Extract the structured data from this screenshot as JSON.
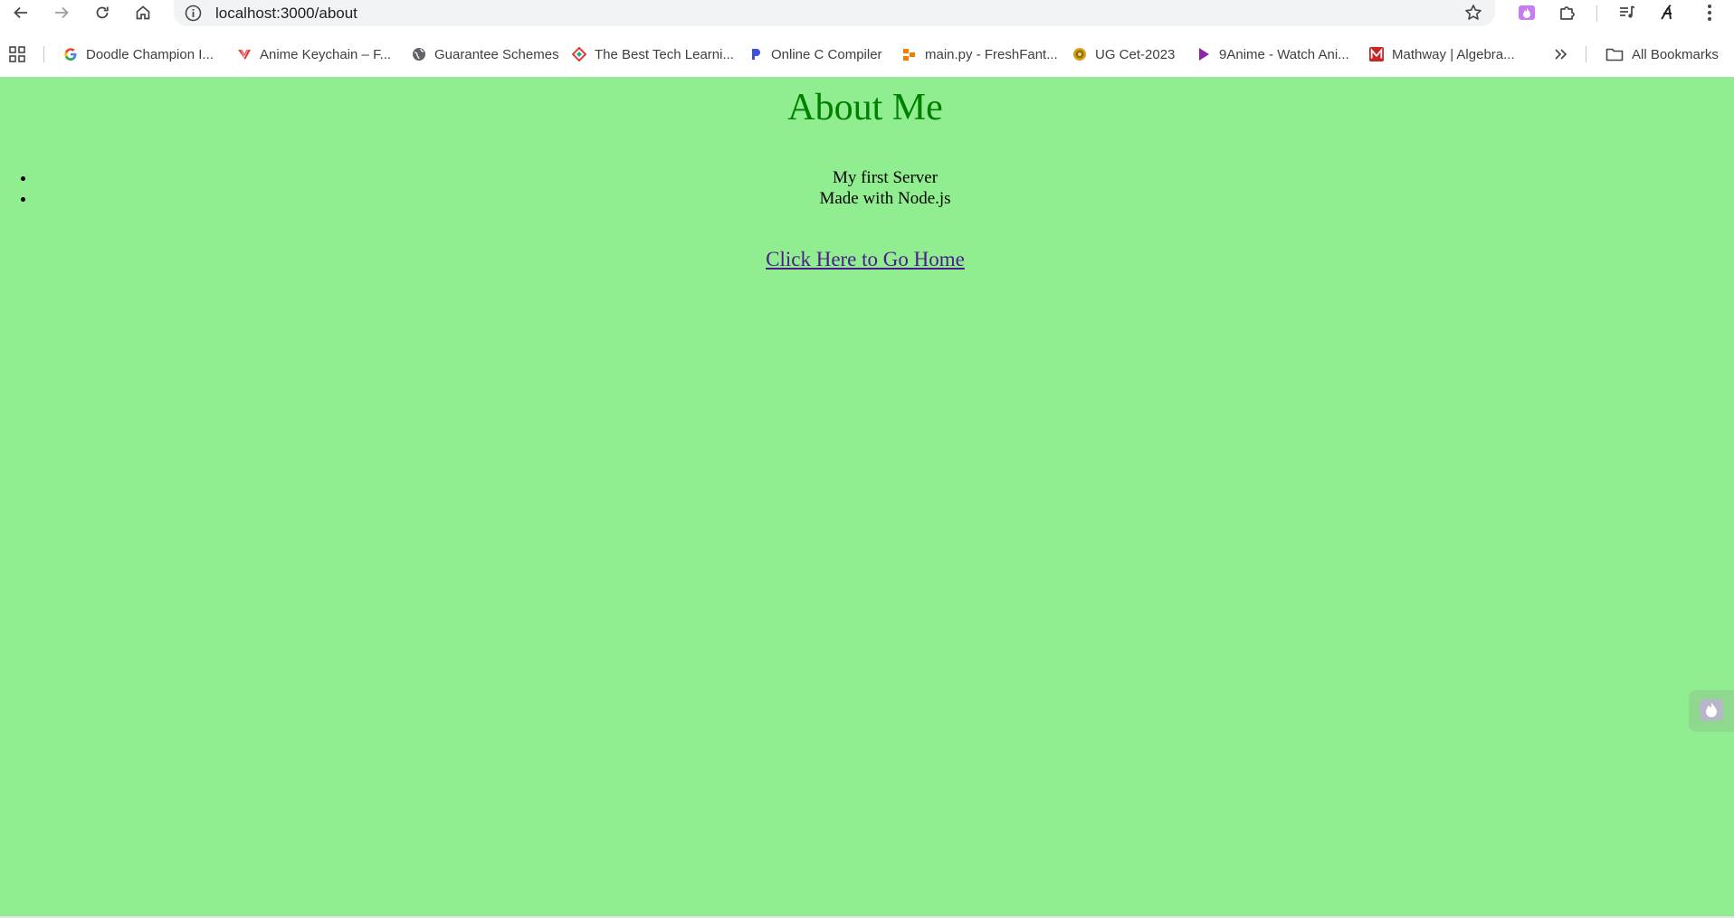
{
  "browser": {
    "url": "localhost:3000/about",
    "bookmarks": [
      {
        "label": "Doodle Champion I...",
        "icon": "google-icon"
      },
      {
        "label": "Anime Keychain – F...",
        "icon": "anime-keychain-icon"
      },
      {
        "label": "Guarantee Schemes",
        "icon": "globe-icon"
      },
      {
        "label": "The Best Tech Learni...",
        "icon": "tech-learning-icon"
      },
      {
        "label": "Online C Compiler",
        "icon": "compiler-icon"
      },
      {
        "label": "main.py - FreshFant...",
        "icon": "freshfantasy-icon"
      },
      {
        "label": "UG Cet-2023",
        "icon": "ugcet-icon"
      },
      {
        "label": "9Anime - Watch Ani...",
        "icon": "play-icon"
      },
      {
        "label": "Mathway | Algebra...",
        "icon": "mathway-icon"
      }
    ],
    "all_bookmarks_label": "All Bookmarks"
  },
  "page": {
    "title": "About Me",
    "items": [
      "My first Server",
      "Made with Node.js"
    ],
    "home_link": "Click Here to Go Home"
  },
  "colors": {
    "page_background": "#90ee90",
    "title": "#008000",
    "link": "#4b1a8b"
  }
}
